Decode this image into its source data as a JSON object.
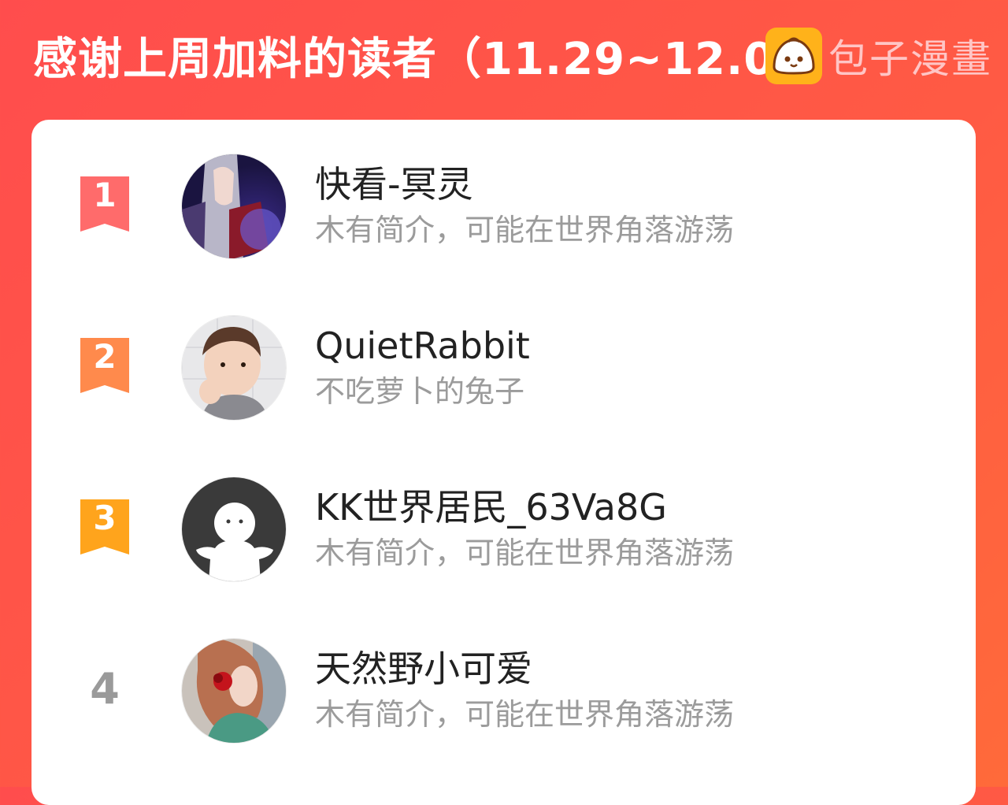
{
  "header": {
    "title": "感谢上周加料的读者（11.29~12.05）"
  },
  "brand": {
    "name": "包子漫畫",
    "icon": "bun-mascot-icon"
  },
  "colors": {
    "background": "#ff4d4d",
    "rank1": "#ff6b6b",
    "rank2": "#ff8a4c",
    "rank3": "#ffa41c",
    "brand_icon": "#ffb21a"
  },
  "readers": [
    {
      "rank": "1",
      "name": "快看-冥灵",
      "bio": "木有简介，可能在世界角落游荡",
      "avatar": "anime-character-avatar"
    },
    {
      "rank": "2",
      "name": "QuietRabbit",
      "bio": "不吃萝卜的兔子",
      "avatar": "child-photo-avatar"
    },
    {
      "rank": "3",
      "name": "KK世界居民_63Va8G",
      "bio": "木有简介，可能在世界角落游荡",
      "avatar": "default-user-avatar"
    },
    {
      "rank": "4",
      "name": "天然野小可爱",
      "bio": "木有简介，可能在世界角落游荡",
      "avatar": "woman-photo-avatar"
    }
  ]
}
